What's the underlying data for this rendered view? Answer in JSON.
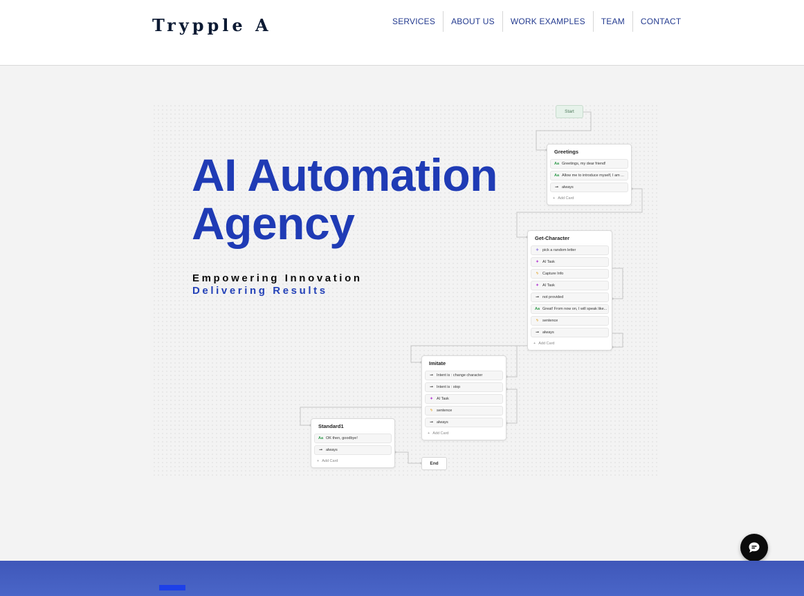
{
  "header": {
    "logo": "Trypple A",
    "nav": [
      "SERVICES",
      "ABOUT US",
      "WORK EXAMPLES",
      "TEAM",
      "CONTACT"
    ]
  },
  "hero": {
    "title_line1": "AI Automation",
    "title_line2": "Agency",
    "tagline1": "Empowering Innovation",
    "tagline2": "Delivering Results"
  },
  "flow": {
    "start": "Start",
    "end": "End",
    "add_card": "Add Card",
    "greetings": {
      "title": "Greetings",
      "cards": [
        {
          "icon": "text-icon",
          "label": "Greetings, my dear friend!"
        },
        {
          "icon": "arrow-icon",
          "label": "Allow me to introduce myself, I am ..."
        },
        {
          "icon": "arrow-icon",
          "label": "always"
        }
      ]
    },
    "get_character": {
      "title": "Get-Character",
      "cards": [
        {
          "icon": "sparkle-icon",
          "label": "pick a random letter"
        },
        {
          "icon": "ai-task-icon",
          "label": "AI Task"
        },
        {
          "icon": "capture-icon",
          "label": "Capture Info"
        },
        {
          "icon": "ai-task-icon",
          "label": "AI Task"
        },
        {
          "icon": "arrow-icon",
          "label": "not provided"
        },
        {
          "icon": "text-icon",
          "label": "Great! From now on, I will speak like..."
        },
        {
          "icon": "capture-icon",
          "label": "sentence"
        },
        {
          "icon": "arrow-icon",
          "label": "always"
        }
      ]
    },
    "imitate": {
      "title": "Imitate",
      "cards": [
        {
          "icon": "arrow-icon",
          "label": "Intent is : change character"
        },
        {
          "icon": "arrow-icon",
          "label": "Intent is : stop"
        },
        {
          "icon": "ai-task-icon",
          "label": "AI Task"
        },
        {
          "icon": "capture-icon",
          "label": "sentence"
        },
        {
          "icon": "arrow-icon",
          "label": "always"
        }
      ]
    },
    "standard1": {
      "title": "Standard1",
      "cards": [
        {
          "icon": "text-icon",
          "label": "OK then, goodbye!"
        },
        {
          "icon": "arrow-icon",
          "label": "always"
        }
      ]
    }
  },
  "colors": {
    "brand_blue": "#1f3bb5",
    "nav_blue": "#233a8f",
    "band_blue": "#4a66c8"
  }
}
